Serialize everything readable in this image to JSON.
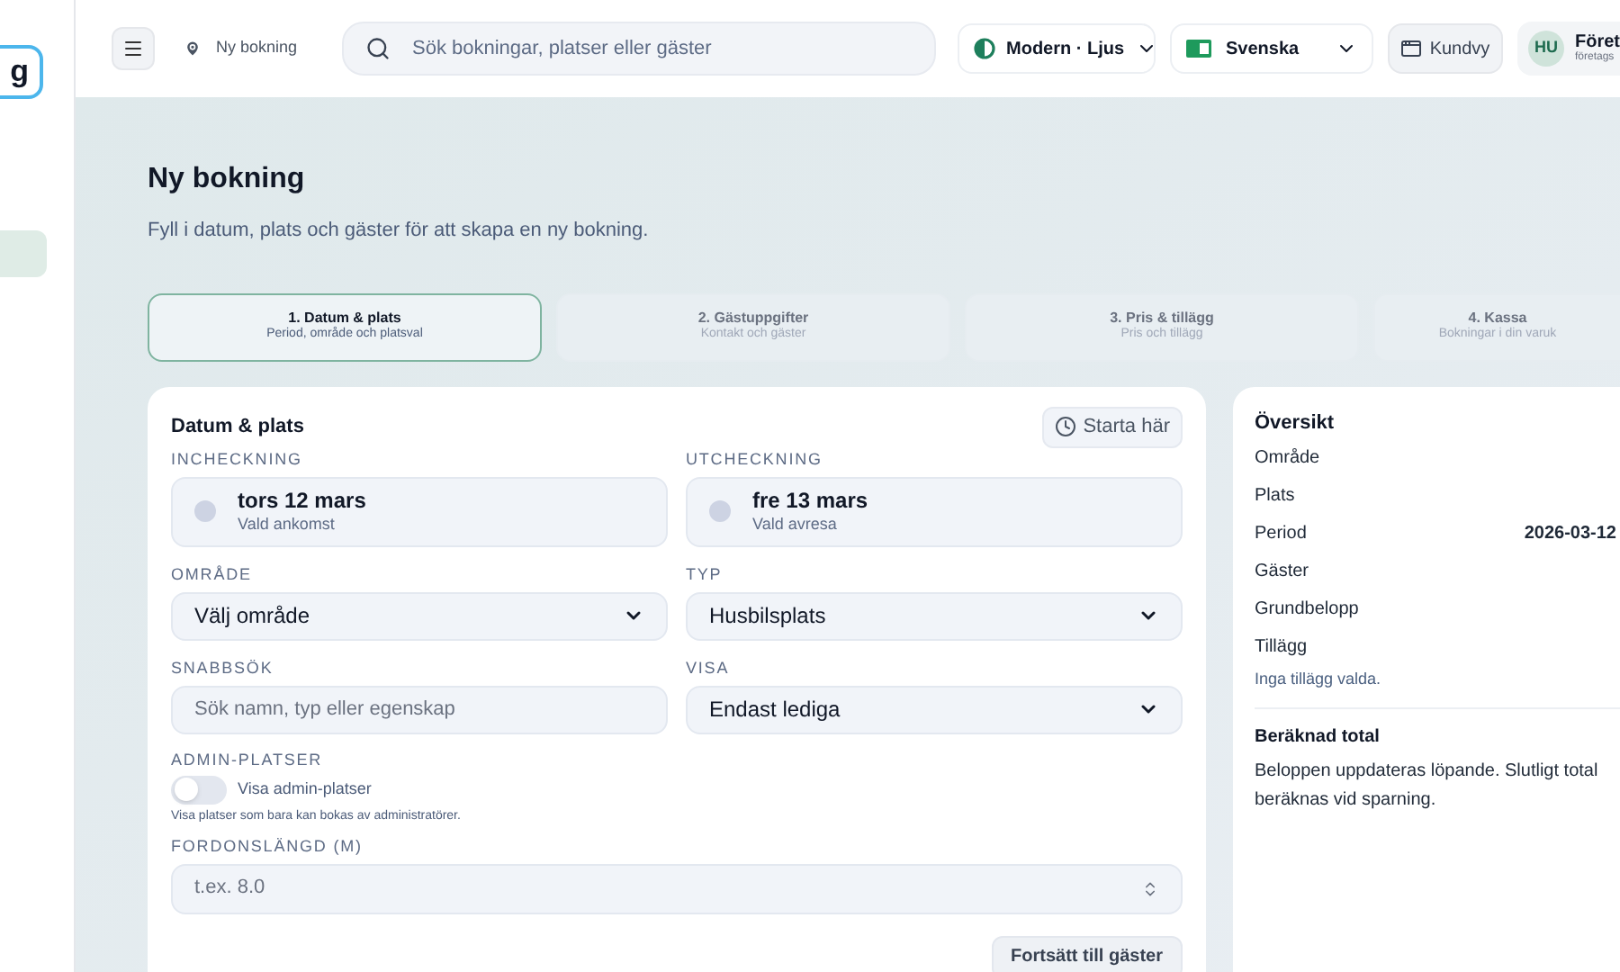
{
  "sidebar": {
    "items": [
      {
        "label": "g",
        "selected": true
      }
    ]
  },
  "header": {
    "breadcrumb": "Ny bokning",
    "search": {
      "placeholder": "Sök bokningar, platser eller gäster"
    },
    "theme": "Modern · Ljus",
    "language": "Svenska",
    "customer_view": "Kundvy",
    "profile": {
      "initials": "HU",
      "name": "Föret",
      "role": "företags"
    }
  },
  "page": {
    "title": "Ny bokning",
    "subtitle": "Fyll i datum, plats och gäster för att skapa en ny bokning."
  },
  "steps": [
    {
      "title": "1. Datum & plats",
      "subtitle": "Period, område och platsval",
      "selected": true
    },
    {
      "title": "2. Gästuppgifter",
      "subtitle": "Kontakt och gäster",
      "selected": false
    },
    {
      "title": "3. Pris & tillägg",
      "subtitle": "Pris och tillägg",
      "selected": false
    },
    {
      "title": "4. Kassa",
      "subtitle": "Bokningar i din varuk",
      "selected": false
    }
  ],
  "form": {
    "title": "Datum & plats",
    "start_button": "Starta här",
    "checkin": {
      "label": "INCHECKNING",
      "date": "tors 12 mars",
      "note": "Vald ankomst"
    },
    "checkout": {
      "label": "UTCHECKNING",
      "date": "fre 13 mars",
      "note": "Vald avresa"
    },
    "area": {
      "label": "OMRÅDE",
      "value": "Välj område"
    },
    "type": {
      "label": "TYP",
      "value": "Husbilsplats"
    },
    "quick_search": {
      "label": "SNABBSÖK",
      "placeholder": "Sök namn, typ eller egenskap"
    },
    "show": {
      "label": "VISA",
      "value": "Endast lediga"
    },
    "admin": {
      "label": "ADMIN-PLATSER",
      "toggle_label": "Visa admin-platser",
      "on": false,
      "help": "Visa platser som bara kan bokas av administratörer."
    },
    "vehicle_length": {
      "label": "FORDONSLÄNGD (M)",
      "placeholder": "t.ex. 8.0"
    },
    "continue_button": "Fortsätt till gäster"
  },
  "overview": {
    "title": "Översikt",
    "rows": [
      {
        "label": "Område"
      },
      {
        "label": "Plats"
      },
      {
        "label": "Period",
        "value": "2026-03-12"
      },
      {
        "label": "Gäster"
      },
      {
        "label": "Grundbelopp"
      },
      {
        "label": "Tillägg"
      }
    ],
    "note": "Inga tillägg valda.",
    "total_title": "Beräknad total",
    "total_text": "Beloppen uppdateras löpande. Slutligt total beräknas vid sparning."
  }
}
